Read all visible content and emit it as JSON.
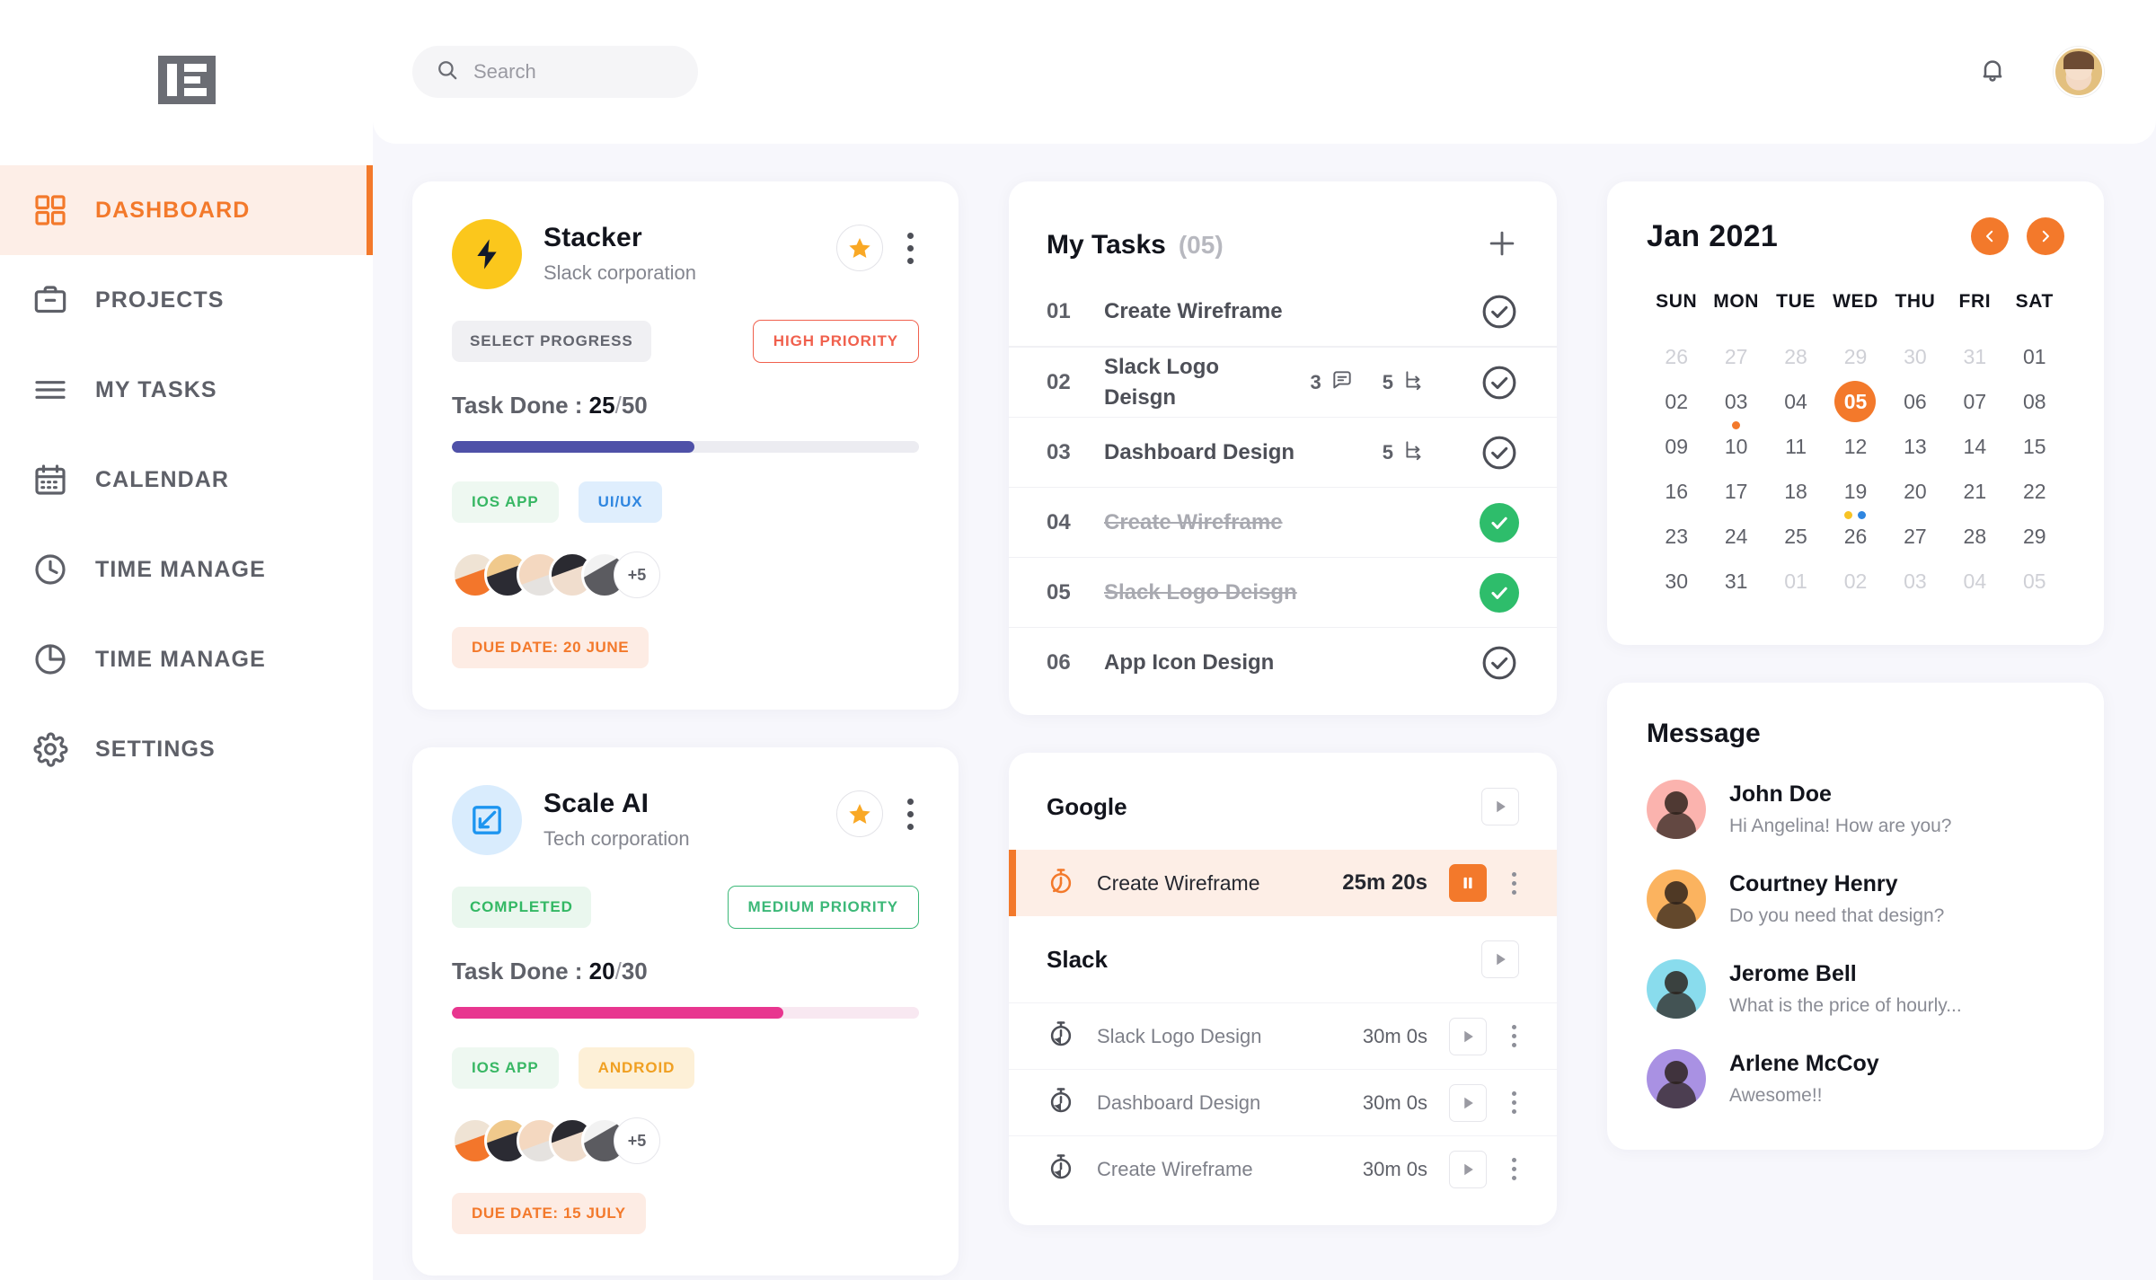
{
  "sidebar": {
    "logo_name": "brand-logo",
    "items": [
      {
        "label": "DASHBOARD",
        "icon": "grid-icon",
        "active": true
      },
      {
        "label": "PROJECTS",
        "icon": "briefcase-icon",
        "active": false
      },
      {
        "label": "MY TASKS",
        "icon": "list-icon",
        "active": false
      },
      {
        "label": "CALENDAR",
        "icon": "calendar-icon",
        "active": false
      },
      {
        "label": "TIME MANAGE",
        "icon": "clock-icon",
        "active": false
      },
      {
        "label": "TIME MANAGE",
        "icon": "pie-chart-icon",
        "active": false
      },
      {
        "label": "SETTINGS",
        "icon": "gear-icon",
        "active": false
      }
    ]
  },
  "topbar": {
    "search_placeholder": "Search",
    "search_value": "",
    "bell_icon": "bell-icon",
    "avatar_name": "user-avatar"
  },
  "projects": [
    {
      "name": "Stacker",
      "company": "Slack corporation",
      "icon": "lightning-bolt-icon",
      "status_label": "SELECT PROGRESS",
      "priority_label": "HIGH PRIORITY",
      "task_done_label": "Task Done :",
      "done": "25",
      "total": "50",
      "progress_pct": 52,
      "progress_color": "#4f51a8",
      "tags": [
        {
          "label": "IOS APP",
          "style": "ios"
        },
        {
          "label": "UI/UX",
          "style": "uiux"
        }
      ],
      "extra_members": "+5",
      "due": "DUE DATE: 20 JUNE"
    },
    {
      "name": "Scale AI",
      "company": "Tech corporation",
      "icon": "expand-arrows-icon",
      "status_label": "COMPLETED",
      "priority_label": "MEDIUM PRIORITY",
      "task_done_label": "Task Done :",
      "done": "20",
      "total": "30",
      "progress_pct": 71,
      "progress_color": "#e8368f",
      "tags": [
        {
          "label": "IOS APP",
          "style": "ios"
        },
        {
          "label": "ANDROID",
          "style": "android"
        }
      ],
      "extra_members": "+5",
      "due": "DUE DATE: 15 JULY"
    }
  ],
  "my_tasks": {
    "title": "My Tasks",
    "count": "(05)",
    "add_icon": "plus-icon",
    "rows": [
      {
        "num": "01",
        "name": "Create Wireframe",
        "comments": "",
        "subtasks": "",
        "done": false
      },
      {
        "num": "02",
        "name": "Slack Logo Deisgn",
        "comments": "3",
        "subtasks": "5",
        "done": false
      },
      {
        "num": "03",
        "name": "Dashboard Design",
        "comments": "",
        "subtasks": "5",
        "done": false
      },
      {
        "num": "04",
        "name": "Create Wireframe",
        "comments": "",
        "subtasks": "",
        "done": true
      },
      {
        "num": "05",
        "name": "Slack Logo Deisgn",
        "comments": "",
        "subtasks": "",
        "done": true
      },
      {
        "num": "06",
        "name": "App Icon Design",
        "comments": "",
        "subtasks": "",
        "done": false
      }
    ]
  },
  "timer": {
    "groups": [
      {
        "name": "Google",
        "rows": [
          {
            "name": "Create Wireframe",
            "time": "25m 20s",
            "active": true,
            "state": "pause"
          }
        ]
      },
      {
        "name": "Slack",
        "rows": [
          {
            "name": "Slack Logo Design",
            "time": "30m 0s",
            "active": false,
            "state": "play"
          },
          {
            "name": "Dashboard Design",
            "time": "30m 0s",
            "active": false,
            "state": "play"
          },
          {
            "name": "Create Wireframe",
            "time": "30m 0s",
            "active": false,
            "state": "play"
          }
        ]
      }
    ]
  },
  "calendar": {
    "title": "Jan 2021",
    "prev_icon": "chevron-left-icon",
    "next_icon": "chevron-right-icon",
    "dow": [
      "SUN",
      "MON",
      "TUE",
      "WED",
      "THU",
      "FRI",
      "SAT"
    ],
    "weeks": [
      [
        {
          "d": "26",
          "muted": true
        },
        {
          "d": "27",
          "muted": true
        },
        {
          "d": "28",
          "muted": true
        },
        {
          "d": "29",
          "muted": true
        },
        {
          "d": "30",
          "muted": true
        },
        {
          "d": "31",
          "muted": true
        },
        {
          "d": "01",
          "muted": false
        }
      ],
      [
        {
          "d": "02",
          "muted": false
        },
        {
          "d": "03",
          "muted": false,
          "dots": [
            "#f3792b"
          ]
        },
        {
          "d": "04",
          "muted": false
        },
        {
          "d": "05",
          "muted": false,
          "selected": true
        },
        {
          "d": "06",
          "muted": false
        },
        {
          "d": "07",
          "muted": false
        },
        {
          "d": "08",
          "muted": false
        }
      ],
      [
        {
          "d": "09",
          "muted": false
        },
        {
          "d": "10",
          "muted": false
        },
        {
          "d": "11",
          "muted": false
        },
        {
          "d": "12",
          "muted": false
        },
        {
          "d": "13",
          "muted": false
        },
        {
          "d": "14",
          "muted": false
        },
        {
          "d": "15",
          "muted": false
        }
      ],
      [
        {
          "d": "16",
          "muted": false
        },
        {
          "d": "17",
          "muted": false
        },
        {
          "d": "18",
          "muted": false
        },
        {
          "d": "19",
          "muted": false,
          "dots": [
            "#f7c325",
            "#2f86e0"
          ]
        },
        {
          "d": "20",
          "muted": false
        },
        {
          "d": "21",
          "muted": false
        },
        {
          "d": "22",
          "muted": false
        }
      ],
      [
        {
          "d": "23",
          "muted": false
        },
        {
          "d": "24",
          "muted": false
        },
        {
          "d": "25",
          "muted": false
        },
        {
          "d": "26",
          "muted": false
        },
        {
          "d": "27",
          "muted": false
        },
        {
          "d": "28",
          "muted": false
        },
        {
          "d": "29",
          "muted": false
        }
      ],
      [
        {
          "d": "30",
          "muted": false
        },
        {
          "d": "31",
          "muted": false
        },
        {
          "d": "01",
          "muted": true
        },
        {
          "d": "02",
          "muted": true
        },
        {
          "d": "03",
          "muted": true
        },
        {
          "d": "04",
          "muted": true
        },
        {
          "d": "05",
          "muted": true
        }
      ]
    ]
  },
  "message": {
    "title": "Message",
    "items": [
      {
        "name": "John Doe",
        "text": "Hi Angelina! How are you?",
        "color": "c1"
      },
      {
        "name": "Courtney Henry",
        "text": "Do you need that design?",
        "color": "c2"
      },
      {
        "name": "Jerome Bell",
        "text": "What is the price of hourly...",
        "color": "c3"
      },
      {
        "name": "Arlene McCoy",
        "text": "Awesome!!",
        "color": "c4"
      }
    ]
  },
  "colors": {
    "accent": "#f3792b",
    "green": "#2ebd6b",
    "indigo": "#4f51a8",
    "pink": "#e8368f",
    "red": "#f0604d",
    "yellow": "#fbc71c",
    "blue": "#2f86e0"
  }
}
